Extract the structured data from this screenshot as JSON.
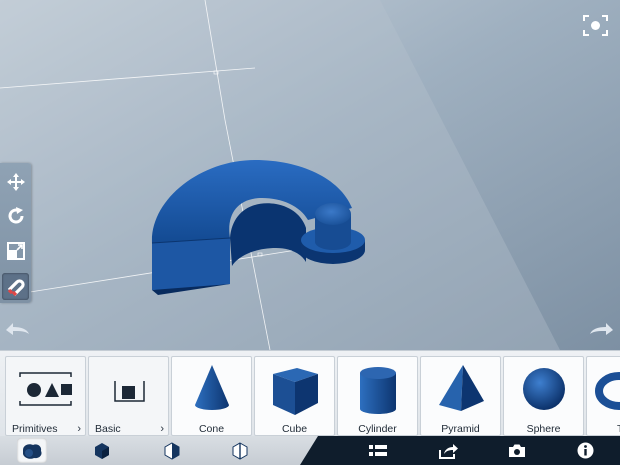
{
  "viewport": {
    "background": "#8e9fb0",
    "model": "blue-arc-with-cylinder-knob",
    "model_color": "#1f5aa8"
  },
  "side_toolbar": [
    {
      "icon": "move-icon",
      "active": false
    },
    {
      "icon": "rotate-icon",
      "active": false
    },
    {
      "icon": "scale-icon",
      "active": false
    },
    {
      "icon": "snap-magnet-icon",
      "active": true
    }
  ],
  "shelf": {
    "categories": [
      {
        "label": "Primitives"
      },
      {
        "label": "Basic"
      }
    ],
    "items": [
      {
        "label": "Cone",
        "icon": "cone-icon"
      },
      {
        "label": "Cube",
        "icon": "cube-icon"
      },
      {
        "label": "Cylinder",
        "icon": "cylinder-icon"
      },
      {
        "label": "Pyramid",
        "icon": "pyramid-icon"
      },
      {
        "label": "Sphere",
        "icon": "sphere-icon"
      },
      {
        "label": "T",
        "icon": "torus-icon"
      }
    ]
  },
  "bottom_bar": {
    "view_modes": [
      {
        "icon": "solid-material-icon",
        "active": true
      },
      {
        "icon": "shaded-icon",
        "active": false
      },
      {
        "icon": "shaded-edges-icon",
        "active": false
      },
      {
        "icon": "wireframe-icon",
        "active": false
      }
    ],
    "actions": [
      {
        "icon": "list-icon"
      },
      {
        "icon": "share-icon"
      },
      {
        "icon": "camera-icon"
      },
      {
        "icon": "info-icon"
      }
    ]
  }
}
